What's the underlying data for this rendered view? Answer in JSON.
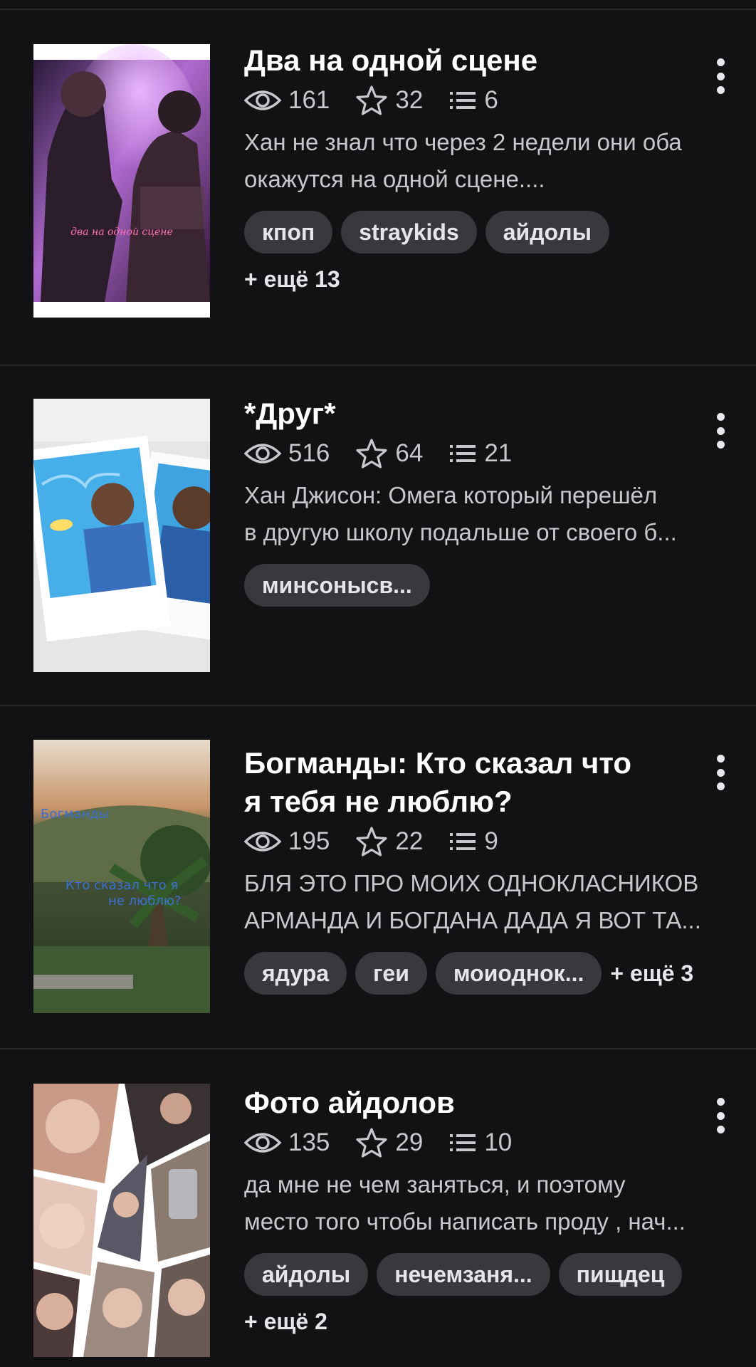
{
  "stories": [
    {
      "title": "Два на одной сцене",
      "views": "161",
      "stars": "32",
      "parts": "6",
      "description": [
        "Хан не знал что через 2 недели они оба",
        "окажутся на одной сцене...."
      ],
      "tags": [
        "кпоп",
        "straykids",
        "айдолы"
      ],
      "more": "+ ещё 13",
      "cover_text": "два на одной сцене"
    },
    {
      "title": "*Друг*",
      "views": "516",
      "stars": "64",
      "parts": "21",
      "description": [
        "Хан Джисон: Омега который перешёл",
        "в другую школу подальше от своего б..."
      ],
      "tags": [
        "минсонысв..."
      ],
      "more": ""
    },
    {
      "title": "Богманды: Кто сказал что я тебя не люблю?",
      "title_lines": [
        "Богманды: Кто сказал что",
        "я тебя не люблю?"
      ],
      "views": "195",
      "stars": "22",
      "parts": "9",
      "description": [
        "БЛЯ ЭТО ПРО МОИХ ОДНОКЛАСНИКОВ",
        "АРМАНДА И БОГДАНА ДАДА Я ВОТ ТА..."
      ],
      "tags": [
        "ядура",
        "геи",
        "моиоднок..."
      ],
      "more": "+ ещё 3",
      "cover_text": [
        "Богманды",
        "Кто сказал что я",
        "не люблю?"
      ]
    },
    {
      "title": "Фото айдолов",
      "views": "135",
      "stars": "29",
      "parts": "10",
      "description": [
        "да мне не чем заняться,  и поэтому",
        "место того чтобы написать проду , нач..."
      ],
      "tags": [
        "айдолы",
        "нечемзаня...",
        "пищдец"
      ],
      "more": "+ ещё 2"
    }
  ],
  "colors": {
    "background": "#121114",
    "tag_bg": "#39383d",
    "secondary_text": "#c8c7cc",
    "separator": "#2a292d"
  }
}
